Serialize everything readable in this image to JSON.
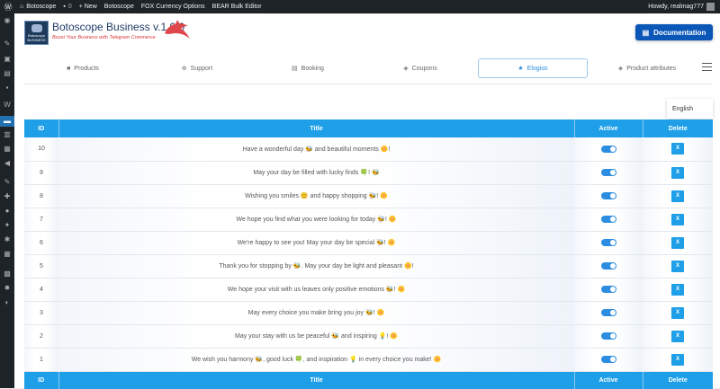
{
  "adminbar": {
    "site": "Botoscope",
    "comments": "0",
    "new_label": "+ New",
    "links": [
      "Botoscope",
      "FOX Currency Options",
      "BEAR Bulk Editor"
    ],
    "howdy": "Howdy, realmag777"
  },
  "brand": {
    "title": "Botoscope Business v.1.0.0",
    "subtitle": "Boost Your Business with Telegram Commerce",
    "logo_line1": "Botoscope",
    "logo_line2": "BUSINESS"
  },
  "documentation_label": "Documentation",
  "tabs": [
    {
      "label": "Products",
      "icon": "bag-icon",
      "glyph": "■"
    },
    {
      "label": "Support",
      "icon": "lifebuoy-icon",
      "glyph": "⊕"
    },
    {
      "label": "Booking",
      "icon": "calendar-icon",
      "glyph": "▤"
    },
    {
      "label": "Coupons",
      "icon": "tag-icon",
      "glyph": "◈"
    },
    {
      "label": "Elogios",
      "icon": "star-icon",
      "glyph": "★"
    },
    {
      "label": "Product attributes",
      "icon": "tags-icon",
      "glyph": "◈"
    }
  ],
  "language": "English",
  "table": {
    "columns": [
      "ID",
      "Title",
      "Active",
      "Delete"
    ],
    "delete_label": "X",
    "rows": [
      {
        "id": "10",
        "title": "Have a wonderful day 🐝 and beautiful moments 🌼!",
        "active": true
      },
      {
        "id": "9",
        "title": "May your day be filled with lucky finds 🍀! 🐝",
        "active": true
      },
      {
        "id": "8",
        "title": "Wishing you smiles 😊 and happy shopping 🐝! 🌼",
        "active": true
      },
      {
        "id": "7",
        "title": "We hope you find what you were looking for today 🐝! 🌼",
        "active": true
      },
      {
        "id": "6",
        "title": "We're happy to see you! May your day be special 🐝! 🌼",
        "active": true
      },
      {
        "id": "5",
        "title": "Thank you for stopping by 🐝. May your day be light and pleasant 🌼!",
        "active": true
      },
      {
        "id": "4",
        "title": "We hope your visit with us leaves only positive emotions 🐝! 🌼",
        "active": true
      },
      {
        "id": "3",
        "title": "May every choice you make bring you joy 🐝! 🌼",
        "active": true
      },
      {
        "id": "2",
        "title": "May your stay with us be peaceful 🐝 and inspiring 💡! 🌼",
        "active": true
      },
      {
        "id": "1",
        "title": "We wish you harmony 🐝, good luck 🍀, and inspiration 💡 in every choice you make! 🌼",
        "active": true
      }
    ]
  },
  "colors": {
    "accent": "#1e9fe8",
    "doc_button": "#0b57b8",
    "adminbar": "#1d2327",
    "brand_title": "#1f3a66",
    "subtitle": "#d63638"
  }
}
